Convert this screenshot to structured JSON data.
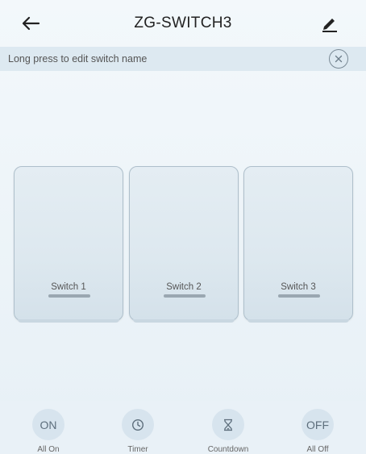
{
  "header": {
    "title": "ZG-SWITCH3",
    "back_icon": "arrow-left-icon",
    "edit_icon": "pencil-icon"
  },
  "hint": {
    "text": "Long press to edit switch name",
    "close_icon": "close-circle-icon"
  },
  "switches": [
    {
      "label": "Switch 1"
    },
    {
      "label": "Switch 2"
    },
    {
      "label": "Switch 3"
    }
  ],
  "actions": [
    {
      "label": "All On",
      "glyph": "ON",
      "icon": "on-icon"
    },
    {
      "label": "Timer",
      "glyph": "",
      "icon": "clock-icon"
    },
    {
      "label": "Countdown",
      "glyph": "",
      "icon": "hourglass-icon"
    },
    {
      "label": "All Off",
      "glyph": "OFF",
      "icon": "off-icon"
    }
  ]
}
